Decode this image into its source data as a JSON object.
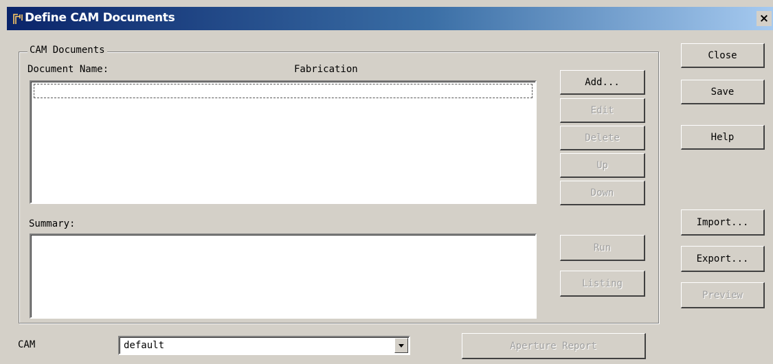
{
  "window": {
    "title": "Define CAM Documents",
    "close_glyph": "×"
  },
  "cam_documents": {
    "group_title": "CAM Documents",
    "document_name_label": "Document Name:",
    "fabrication_label": "Fabrication",
    "summary_label": "Summary:",
    "documents": [],
    "buttons": {
      "add": "Add...",
      "edit": "Edit",
      "delete": "Delete",
      "up": "Up",
      "down": "Down",
      "run": "Run",
      "listing": "Listing"
    }
  },
  "side_buttons": {
    "close": "Close",
    "save": "Save",
    "help": "Help",
    "import": "Import...",
    "export": "Export...",
    "preview": "Preview"
  },
  "cam": {
    "label": "CAM",
    "selected": "default"
  },
  "aperture_report_label": "Aperture Report",
  "colors": {
    "title_bar_start": "#0a246a",
    "title_bar_end": "#a6caf0",
    "face": "#d4d0c8",
    "disabled_text": "#a0a0a0"
  },
  "icons": {
    "app": "cam-app-icon",
    "close": "close-icon",
    "dropdown": "chevron-down-icon"
  }
}
